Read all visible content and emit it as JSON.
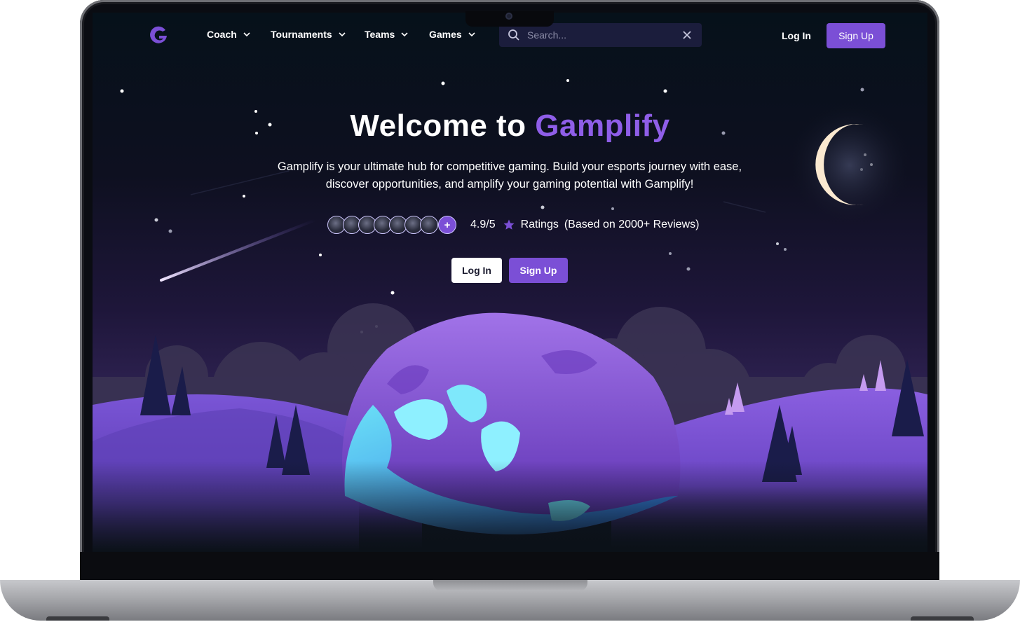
{
  "nav": {
    "logo_letter": "G",
    "items": [
      {
        "label": "Coach"
      },
      {
        "label": "Tournaments"
      },
      {
        "label": "Teams"
      },
      {
        "label": "Games"
      }
    ],
    "search_placeholder": "Search...",
    "login_label": "Log In",
    "signup_label": "Sign Up"
  },
  "hero": {
    "title_prefix": "Welcome to",
    "title_brand": "Gamplify",
    "subtitle": "Gamplify is your ultimate hub for competitive gaming. Build your esports journey with ease, discover opportunities, and amplify your gaming potential with Gamplify!",
    "rating_value": "4.9/5",
    "rating_label": "Ratings",
    "rating_reviews": "(Based on 2000+ Reviews)",
    "avatar_more": "+",
    "login_label": "Log In",
    "signup_label": "Sign Up"
  },
  "icons": {
    "logo": "gamplify-logo-icon",
    "chevron": "chevron-down-icon",
    "search": "search-icon",
    "clear": "close-icon",
    "star": "star-icon"
  },
  "colors": {
    "accent": "#7b4fd6",
    "brand_text": "#8f5ee8",
    "background": "#0e1020"
  }
}
